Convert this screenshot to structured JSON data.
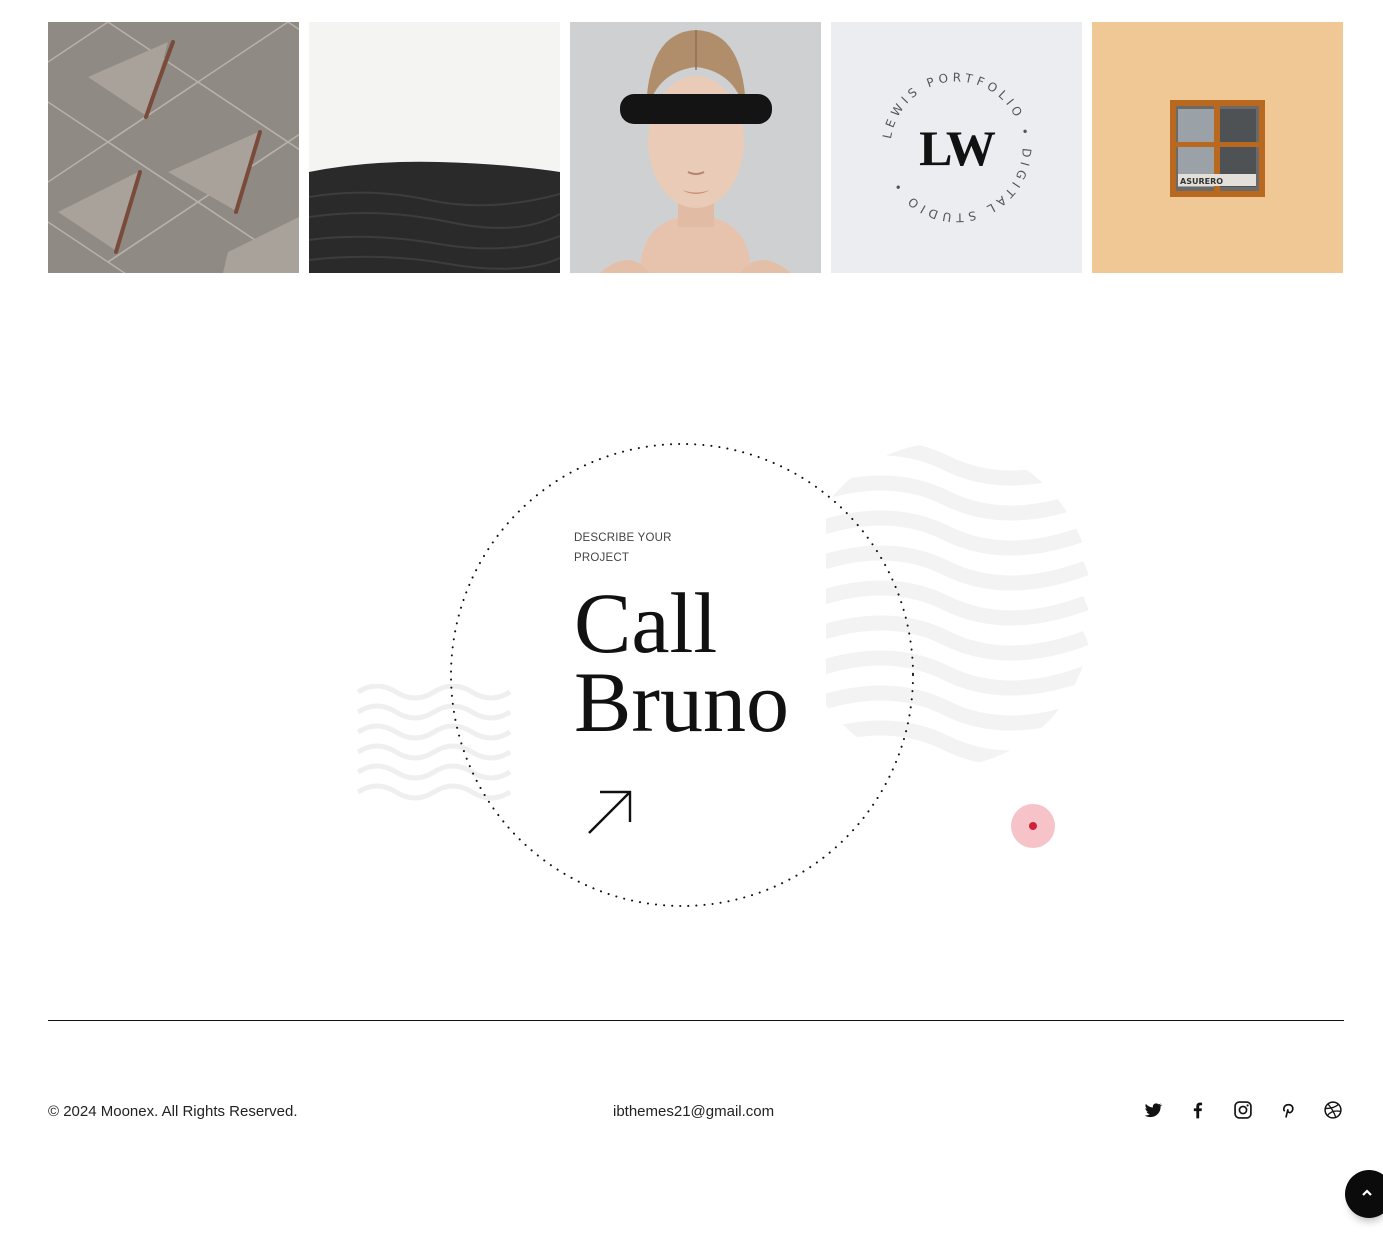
{
  "gallery": {
    "items": [
      {
        "alt": "envelope pattern image"
      },
      {
        "alt": "black sand dune image"
      },
      {
        "alt": "woman wearing visor image"
      },
      {
        "alt": "LW portfolio logo image",
        "logo_initials": "LW",
        "ring_text": "LEWIS PORTFOLIO • DIGITAL STUDIO •"
      },
      {
        "alt": "orange wall window image",
        "sign_text": "ASURERO"
      }
    ]
  },
  "cta": {
    "eyebrow": "DESCRIBE YOUR PROJECT",
    "title_line1": "Call",
    "title_line2": "Bruno",
    "accent_color": "#d0213a",
    "accent_soft_color": "#f6c3c8"
  },
  "footer": {
    "copyright": "© 2024 Moonex. All Rights Reserved.",
    "email": "ibthemes21@gmail.com",
    "socials": [
      {
        "icon": "twitter-icon"
      },
      {
        "icon": "facebook-icon"
      },
      {
        "icon": "instagram-icon"
      },
      {
        "icon": "pinterest-icon"
      },
      {
        "icon": "dribbble-icon"
      }
    ]
  },
  "scroll_top": {
    "icon": "chevron-up-icon"
  }
}
